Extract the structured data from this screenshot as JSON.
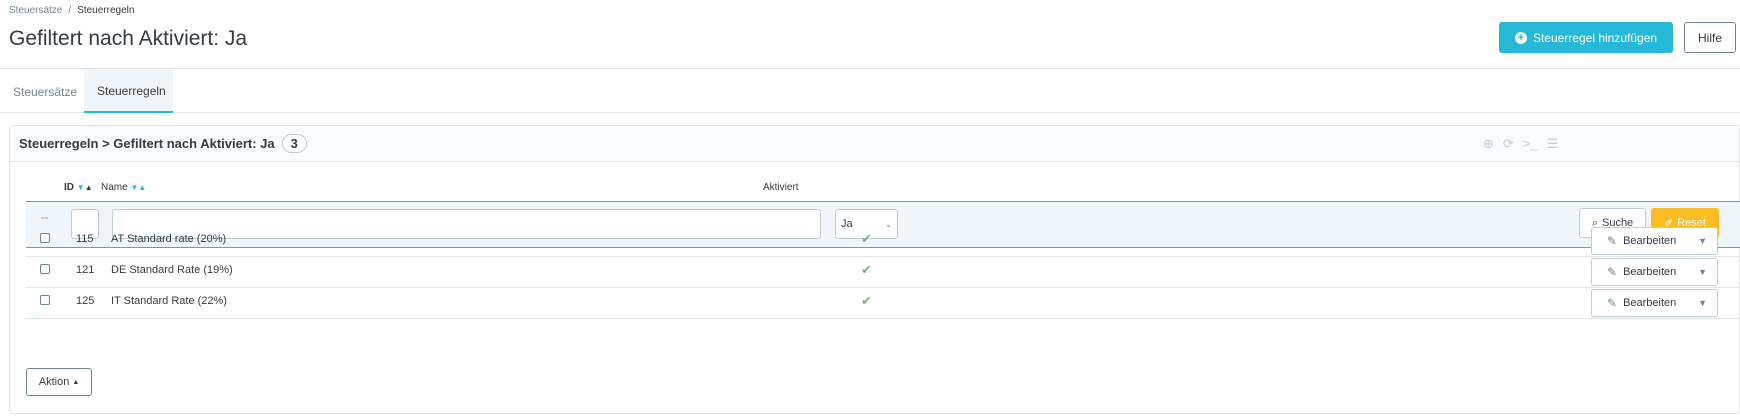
{
  "breadcrumb": {
    "parent": "Steuersätze",
    "separator": "/",
    "current": "Steuerregeln"
  },
  "page_title": "Gefiltert nach Aktiviert: Ja",
  "toolbar": {
    "add_label": "Steuerregel hinzufügen",
    "help_label": "Hilfe"
  },
  "tabs": [
    {
      "label": "Steuersätze",
      "active": false
    },
    {
      "label": "Steuerregeln",
      "active": true
    }
  ],
  "panel": {
    "title": "Steuerregeln > Gefiltert nach Aktiviert: Ja",
    "count": "3"
  },
  "panel_tools": [
    "plus-circle-icon",
    "refresh-icon",
    "terminal-icon",
    "database-icon"
  ],
  "columns": {
    "id": "ID",
    "name": "Name",
    "active": "Aktiviert"
  },
  "filters": {
    "dash": "--",
    "id_value": "",
    "name_value": "",
    "active_selected": "Ja",
    "search_label": "Suche",
    "reset_label": "Reset"
  },
  "rows": [
    {
      "id": "115",
      "name": "AT Standard rate (20%)",
      "active": true,
      "edit_label": "Bearbeiten"
    },
    {
      "id": "121",
      "name": "DE Standard Rate (19%)",
      "active": true,
      "edit_label": "Bearbeiten"
    },
    {
      "id": "125",
      "name": "IT Standard Rate (22%)",
      "active": true,
      "edit_label": "Bearbeiten"
    }
  ],
  "bulk": {
    "action_label": "Aktion"
  },
  "colors": {
    "accent": "#25b9d7",
    "reset": "#fbbb22",
    "success": "#70b580"
  }
}
